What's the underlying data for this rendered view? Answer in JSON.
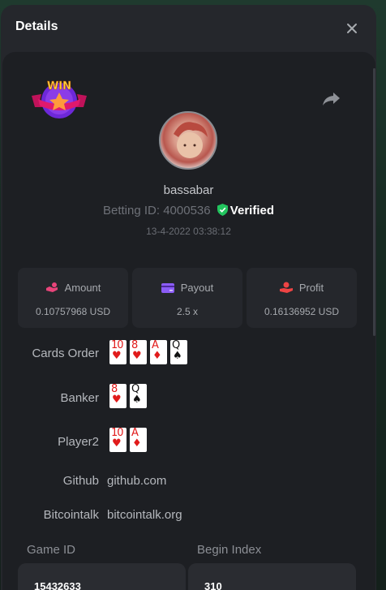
{
  "modal": {
    "title": "Details"
  },
  "player": {
    "username": "bassabar",
    "betting_id_label": "Betting ID:",
    "betting_id": "4000536",
    "verified_label": "Verified",
    "timestamp": "13-4-2022 03:38:12"
  },
  "badge": {
    "text": "WIN"
  },
  "stats": [
    {
      "label": "Amount",
      "value": "0.10757968 USD",
      "icon": "hand-coins-icon"
    },
    {
      "label": "Payout",
      "value": "2.5 x",
      "icon": "card-icon"
    },
    {
      "label": "Profit",
      "value": "0.16136952 USD",
      "icon": "profit-hand-icon"
    }
  ],
  "rows": {
    "cards_order": {
      "label": "Cards Order",
      "cards": [
        {
          "rank": "10",
          "suit": "♥"
        },
        {
          "rank": "8",
          "suit": "♥"
        },
        {
          "rank": "A",
          "suit": "♦"
        },
        {
          "rank": "Q",
          "suit": "♠"
        }
      ]
    },
    "banker": {
      "label": "Banker",
      "cards": [
        {
          "rank": "8",
          "suit": "♥"
        },
        {
          "rank": "Q",
          "suit": "♠"
        }
      ]
    },
    "player2": {
      "label": "Player2",
      "cards": [
        {
          "rank": "10",
          "suit": "♥"
        },
        {
          "rank": "A",
          "suit": "♦"
        }
      ]
    },
    "github": {
      "label": "Github",
      "value": "github.com"
    },
    "bitcointalk": {
      "label": "Bitcointalk",
      "value": "bitcointalk.org"
    }
  },
  "fields": {
    "game_id": {
      "label": "Game ID",
      "value": "15432633"
    },
    "begin_index": {
      "label": "Begin Index",
      "value": "310"
    }
  },
  "colors": {
    "panel": "#25272c",
    "inner": "#1d1f23",
    "amount_icon": "#e8447a",
    "payout_icon": "#8b5cf6",
    "profit_icon": "#ef4444",
    "verified_shield": "#22c55e"
  }
}
